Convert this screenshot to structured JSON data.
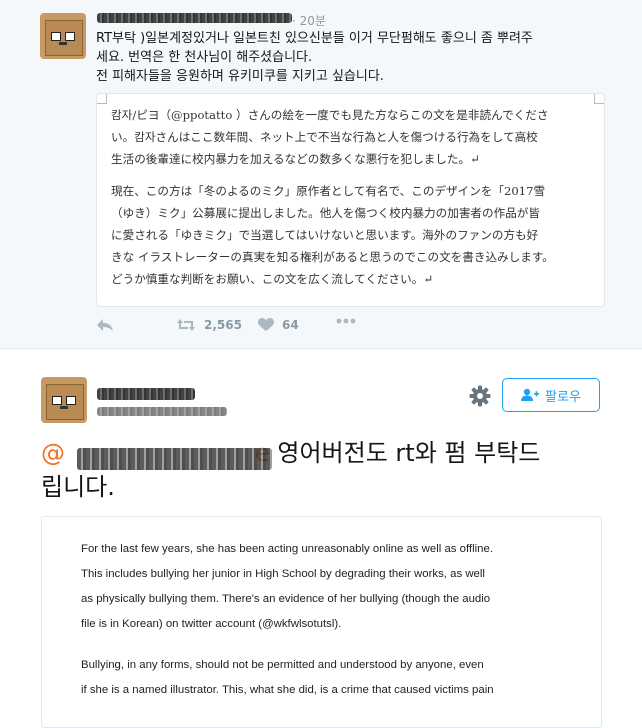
{
  "reply_tweet": {
    "time": "· 20분",
    "body": [
      "RT부탁 )일본계정있거나 일본트친 있으신분들 이거 무단펌해도 좋으니 좀 뿌려주",
      "세요. 번역은 한 천사님이 해주셨습니다.",
      "전 피해자들을 응원하며 유키미쿠를 지키고 싶습니다."
    ],
    "image_text": {
      "para1": [
        "캄자/ピヨ（@ppotatto ）さんの絵を一度でも見た方ならこの文を是非読んでくださ",
        "い。캄자さんはここ数年間、ネット上で不当な行為と人を傷つける行為をして高校",
        "生活の後輩達に校内暴力を加えるなどの数多くな悪行を犯しました。↵"
      ],
      "para2": [
        "現在、この方は「冬のよるのミク」原作者として有名で、このデザインを「2017雪",
        "（ゆき）ミク」公募展に提出しました。他人を傷つく校内暴力の加害者の作品が皆",
        "に愛される「ゆきミク」で当選してはいけないと思います。海外のファンの方も好",
        "きな イラストレーターの真実を知る権利があると思うのでこの文を書き込みします。",
        "どうか慎重な判断をお願い、この文を広く流してください。↵"
      ]
    },
    "actions": {
      "reply_icon": "reply-icon",
      "retweet_icon": "retweet-icon",
      "retweet_count": "2,565",
      "like_icon": "heart-icon",
      "like_count": "64",
      "more_icon": "more-icon"
    }
  },
  "main_tweet": {
    "follow_label": "팔로우",
    "mention_prefix": "@",
    "mention_suffix": "e",
    "text_after_mention": " 영어버전도 rt와 펌 부탁드",
    "text_line2": "립니다.",
    "image_text": {
      "para1": [
        "For the last few years, she has been acting unreasonably online as well as offline.",
        "This includes bullying her junior in High School by degrading their works, as well",
        "as physically bullying them. There's an evidence of her bullying (though the audio",
        "file is in Korean) on twitter account (@wkfwlsotutsl)."
      ],
      "para2": [
        "Bullying, in any forms, should not be permitted and understood by anyone, even",
        "if she is a named illustrator. This, what she did, is a crime that caused victims pain"
      ]
    }
  },
  "colors": {
    "accent": "#1da1f2",
    "mention": "#f36f21",
    "muted": "#8899a6",
    "reply_bg": "#f5f8fa"
  }
}
